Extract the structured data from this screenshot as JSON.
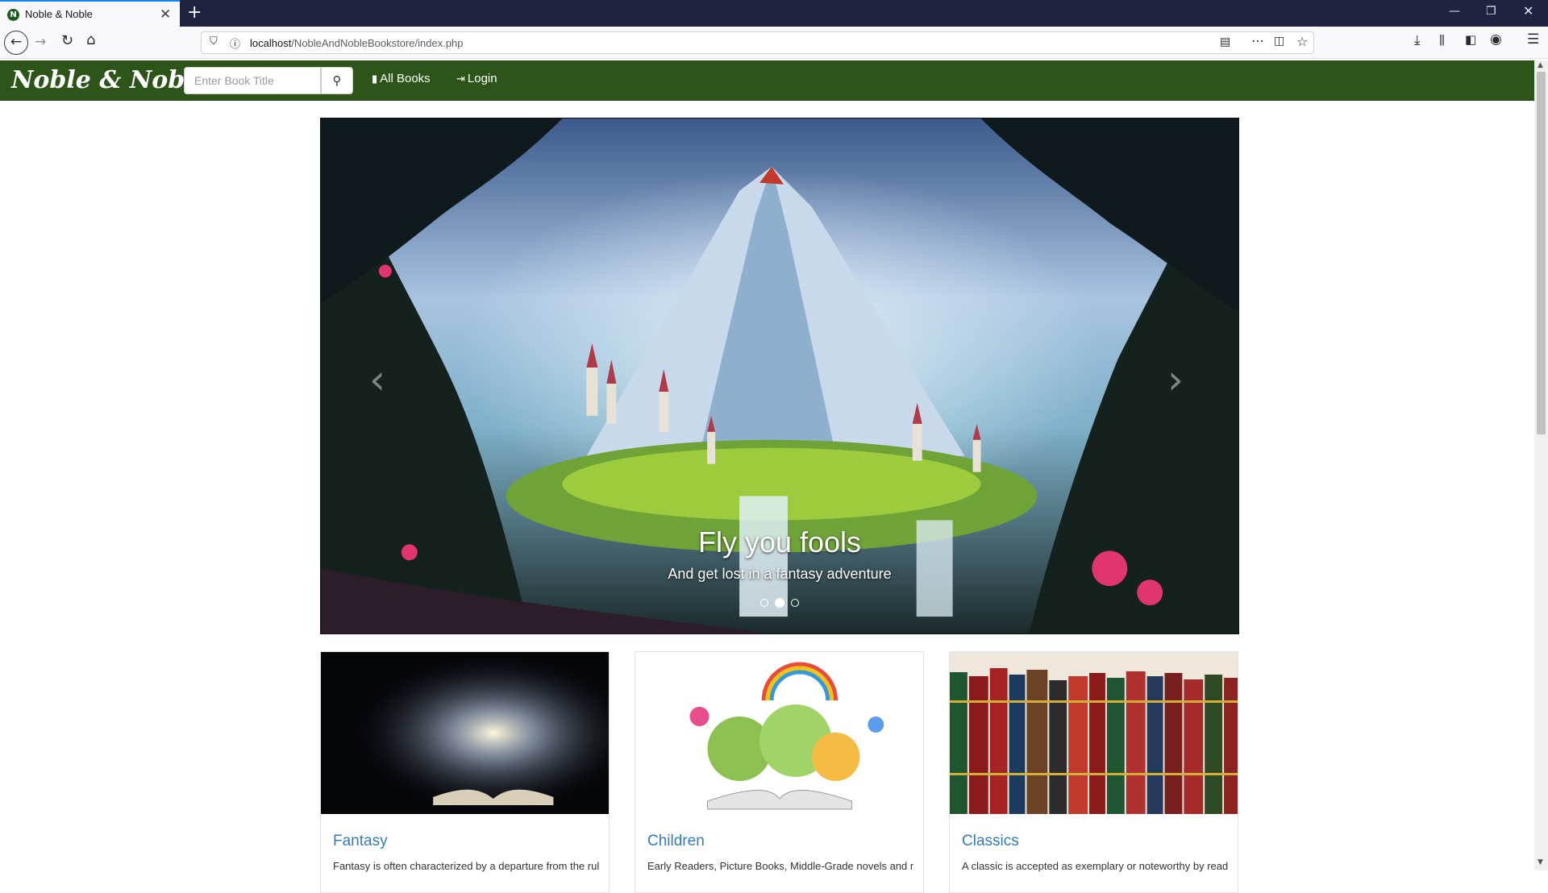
{
  "browser": {
    "tab_title": "Noble & Noble",
    "tab_favicon": "N",
    "url_host": "localhost",
    "url_path": "/NobleAndNobleBookstore/index.php",
    "icons": [
      "back-icon",
      "forward-icon",
      "reload-icon",
      "home-icon",
      "shield-icon",
      "info-icon",
      "reader-icon",
      "more-icon",
      "pocket-icon",
      "bookmark-star-icon",
      "download-icon",
      "library-icon",
      "sidebar-icon",
      "account-icon",
      "menu-icon"
    ]
  },
  "site": {
    "brand": "Noble & Noble",
    "search_placeholder": "Enter Book Title",
    "nav": [
      {
        "label": "All Books",
        "icon": "book-icon"
      },
      {
        "label": "Login",
        "icon": "login-icon"
      }
    ],
    "nav_color": "#2e5519"
  },
  "carousel": {
    "title": "Fly you fools",
    "subtitle": "And get lost in a fantasy adventure",
    "active_slide": 2,
    "slide_count": 3
  },
  "cards": [
    {
      "title": "Fantasy",
      "text": "Fantasy is often characterized by a departure from the rules of reality"
    },
    {
      "title": "Children",
      "text": "Early Readers, Picture Books, Middle-Grade novels and more"
    },
    {
      "title": "Classics",
      "text": "A classic is accepted as exemplary or noteworthy by readers"
    }
  ]
}
